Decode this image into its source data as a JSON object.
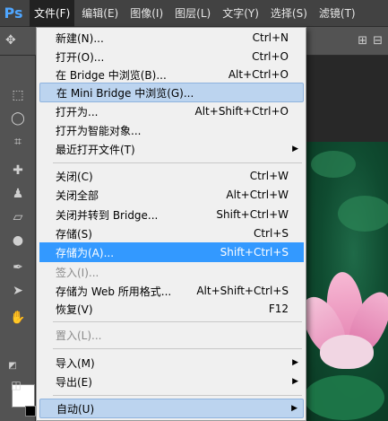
{
  "app": {
    "logo": "Ps"
  },
  "menubar": {
    "items": [
      {
        "label": "文件(F)"
      },
      {
        "label": "编辑(E)"
      },
      {
        "label": "图像(I)"
      },
      {
        "label": "图层(L)"
      },
      {
        "label": "文字(Y)"
      },
      {
        "label": "选择(S)"
      },
      {
        "label": "滤镜(T)"
      }
    ]
  },
  "menu": {
    "items": [
      {
        "label": "新建(N)...",
        "shortcut": "Ctrl+N"
      },
      {
        "label": "打开(O)...",
        "shortcut": "Ctrl+O"
      },
      {
        "label": "在 Bridge 中浏览(B)...",
        "shortcut": "Alt+Ctrl+O"
      },
      {
        "label": "在 Mini Bridge 中浏览(G)...",
        "shortcut": ""
      },
      {
        "label": "打开为...",
        "shortcut": "Alt+Shift+Ctrl+O"
      },
      {
        "label": "打开为智能对象...",
        "shortcut": ""
      },
      {
        "label": "最近打开文件(T)",
        "shortcut": ""
      },
      {
        "label": "关闭(C)",
        "shortcut": "Ctrl+W"
      },
      {
        "label": "关闭全部",
        "shortcut": "Alt+Ctrl+W"
      },
      {
        "label": "关闭并转到 Bridge...",
        "shortcut": "Shift+Ctrl+W"
      },
      {
        "label": "存储(S)",
        "shortcut": "Ctrl+S"
      },
      {
        "label": "存储为(A)...",
        "shortcut": "Shift+Ctrl+S"
      },
      {
        "label": "签入(I)...",
        "shortcut": ""
      },
      {
        "label": "存储为 Web 所用格式...",
        "shortcut": "Alt+Shift+Ctrl+S"
      },
      {
        "label": "恢复(V)",
        "shortcut": "F12"
      },
      {
        "label": "置入(L)...",
        "shortcut": ""
      },
      {
        "label": "导入(M)",
        "shortcut": ""
      },
      {
        "label": "导出(E)",
        "shortcut": ""
      },
      {
        "label": "自动(U)",
        "shortcut": ""
      }
    ]
  },
  "colors": {
    "selected": "#3399ff",
    "highlight": "#bcd4ef",
    "foreground_swatch": "#ffffff",
    "background_swatch": "#000000"
  }
}
